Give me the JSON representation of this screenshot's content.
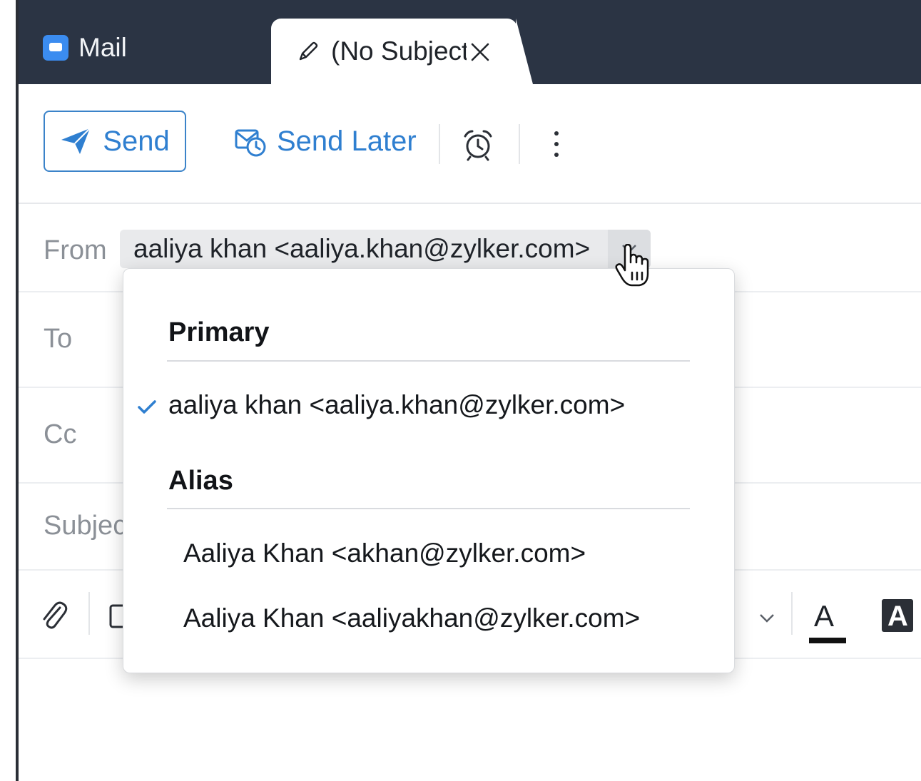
{
  "tabs": {
    "mail_label": "Mail",
    "compose_title": "(No Subject)"
  },
  "toolbar": {
    "send_label": "Send",
    "send_later_label": "Send Later"
  },
  "fields": {
    "from_label": "From",
    "from_value": "aaliya khan <aaliya.khan@zylker.com>",
    "to_label": "To",
    "cc_label": "Cc",
    "subject_label": "Subject"
  },
  "from_dropdown": {
    "primary_heading": "Primary",
    "primary_address": "aaliya khan <aaliya.khan@zylker.com>",
    "alias_heading": "Alias",
    "aliases": [
      "Aaliya Khan <akhan@zylker.com>",
      "Aaliya Khan <aaliyakhan@zylker.com>"
    ]
  },
  "format_bar": {
    "text_color_letter": "A",
    "highlight_letter": "A"
  },
  "colors": {
    "tab_bar": "#2b3444",
    "accent": "#2f7fd0",
    "mail_icon": "#3b8cf0"
  },
  "icons": [
    "mail-icon",
    "pencil-icon",
    "close-icon",
    "send-icon",
    "send-later-icon",
    "alarm-icon",
    "more-icon",
    "chevron-down-icon",
    "check-icon",
    "attachment-icon",
    "text-color-icon",
    "highlight-icon",
    "hand-cursor-icon"
  ]
}
